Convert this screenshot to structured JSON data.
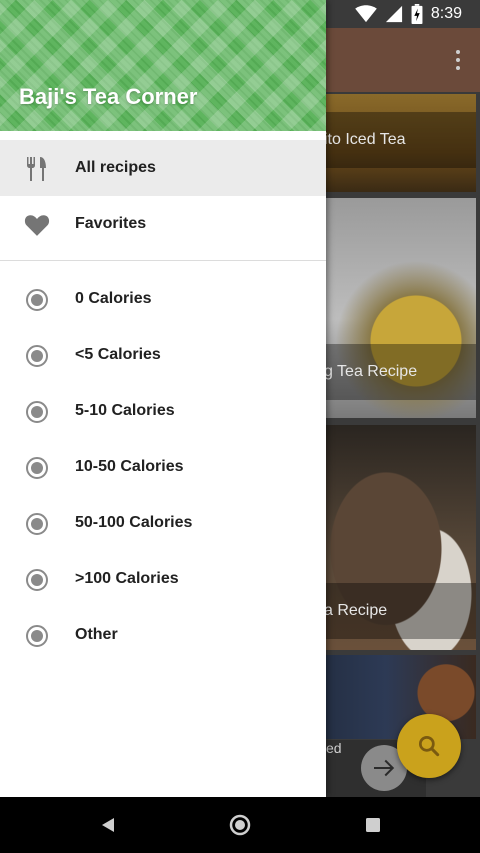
{
  "status_bar": {
    "time": "8:39",
    "left_icons": [
      "settings-icon",
      "shield-icon",
      "sd-card-icon",
      "loading-circle-icon"
    ],
    "right_icons": [
      "wifi-icon",
      "signal-icon",
      "battery-charging-icon"
    ]
  },
  "drawer": {
    "header_title": "Baji's Tea Corner",
    "primary_items": [
      {
        "label": "All recipes",
        "icon": "fork-knife-icon",
        "active": true
      },
      {
        "label": "Favorites",
        "icon": "heart-icon",
        "active": false
      }
    ],
    "calorie_items": [
      {
        "label": "0 Calories",
        "icon": "radio-icon"
      },
      {
        "label": "<5 Calories",
        "icon": "radio-icon"
      },
      {
        "label": "5-10 Calories",
        "icon": "radio-icon"
      },
      {
        "label": "10-50 Calories",
        "icon": "radio-icon"
      },
      {
        "label": "50-100 Calories",
        "icon": "radio-icon"
      },
      {
        "label": ">100 Calories",
        "icon": "radio-icon"
      },
      {
        "label": "Other",
        "icon": "radio-icon"
      }
    ]
  },
  "background": {
    "cards": [
      {
        "caption": "ito Iced Tea"
      },
      {
        "caption": "g Tea Recipe"
      },
      {
        "caption": "a Recipe"
      },
      {
        "caption": "ed"
      }
    ],
    "fab_icon": "search-icon",
    "arrow_icon": "arrow-right-icon"
  },
  "colors": {
    "header_green": "#5fb55f",
    "fab_amber": "#caa21c",
    "active_bg": "#ebebeb",
    "icon_gray": "#8a8a8a"
  },
  "nav_bar": {
    "buttons": [
      "back-icon",
      "home-icon",
      "recents-icon"
    ]
  }
}
